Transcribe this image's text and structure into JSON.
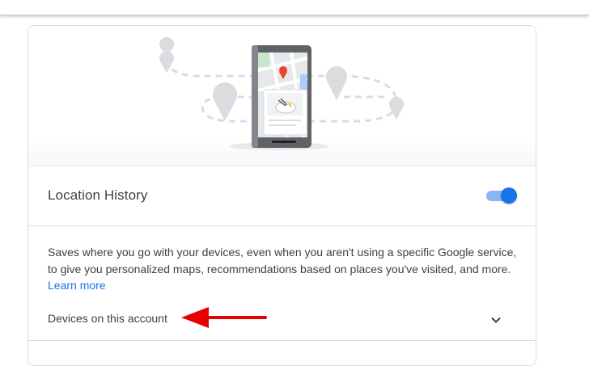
{
  "card": {
    "hero_icon": "phone-map-illustration",
    "location_history": {
      "title": "Location History",
      "toggle_on": true
    },
    "description": {
      "text": "Saves where you go with your devices, even when you aren't using a specific Google service, to give you personalized maps, recommendations based on places you've visited, and more. ",
      "link": "Learn more"
    },
    "devices": {
      "label": "Devices on this account",
      "icon": "chevron-down-icon"
    }
  },
  "annotation": {
    "icon": "red-arrow",
    "color": "#e60000"
  },
  "colors": {
    "accent": "#1a73e8",
    "toggle_track": "#8ab4f8",
    "text": "#3c4043"
  }
}
